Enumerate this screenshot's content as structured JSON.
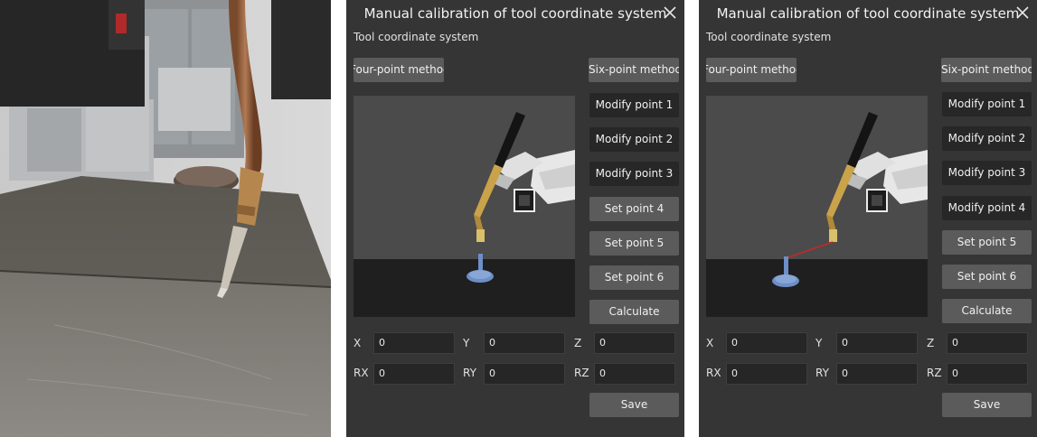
{
  "panels": [
    {
      "title": "Manual calibration of tool coordinate system",
      "subtitle": "Tool coordinate system",
      "four_point_label": "Four-point method",
      "six_point_label": "Six-point method",
      "point_buttons": [
        "Modify point 1",
        "Modify point 2",
        "Modify point 3",
        "Set point 4",
        "Set point 5",
        "Set point 6"
      ],
      "calculate_label": "Calculate",
      "fields": [
        {
          "label": "X",
          "value": "0"
        },
        {
          "label": "Y",
          "value": "0"
        },
        {
          "label": "Z",
          "value": "0"
        },
        {
          "label": "RX",
          "value": "0"
        },
        {
          "label": "RY",
          "value": "0"
        },
        {
          "label": "RZ",
          "value": "0"
        }
      ],
      "save_label": "Save"
    },
    {
      "title": "Manual calibration of tool coordinate system",
      "subtitle": "Tool coordinate system",
      "four_point_label": "Four-point method",
      "six_point_label": "Six-point method",
      "point_buttons": [
        "Modify point 1",
        "Modify point 2",
        "Modify point 3",
        "Modify point 4",
        "Set point 5",
        "Set point 6"
      ],
      "calculate_label": "Calculate",
      "fields": [
        {
          "label": "X",
          "value": "0"
        },
        {
          "label": "Y",
          "value": "0"
        },
        {
          "label": "Z",
          "value": "0"
        },
        {
          "label": "RX",
          "value": "0"
        },
        {
          "label": "RY",
          "value": "0"
        },
        {
          "label": "RZ",
          "value": "0"
        }
      ],
      "save_label": "Save"
    }
  ],
  "colors": {
    "panel_bg": "#353535",
    "button_light": "#5b5b5b",
    "button_dark": "#272727",
    "field_bg": "#262626",
    "viewport_top": "#4b4b4b",
    "viewport_floor": "#1f1f1f",
    "target_blue": "#6d8fc7",
    "laser_red": "#c62828"
  },
  "icons": {
    "close": "close-icon",
    "torch": "welding-torch-icon",
    "robot": "robot-arm-icon",
    "target": "calibration-target-icon"
  }
}
